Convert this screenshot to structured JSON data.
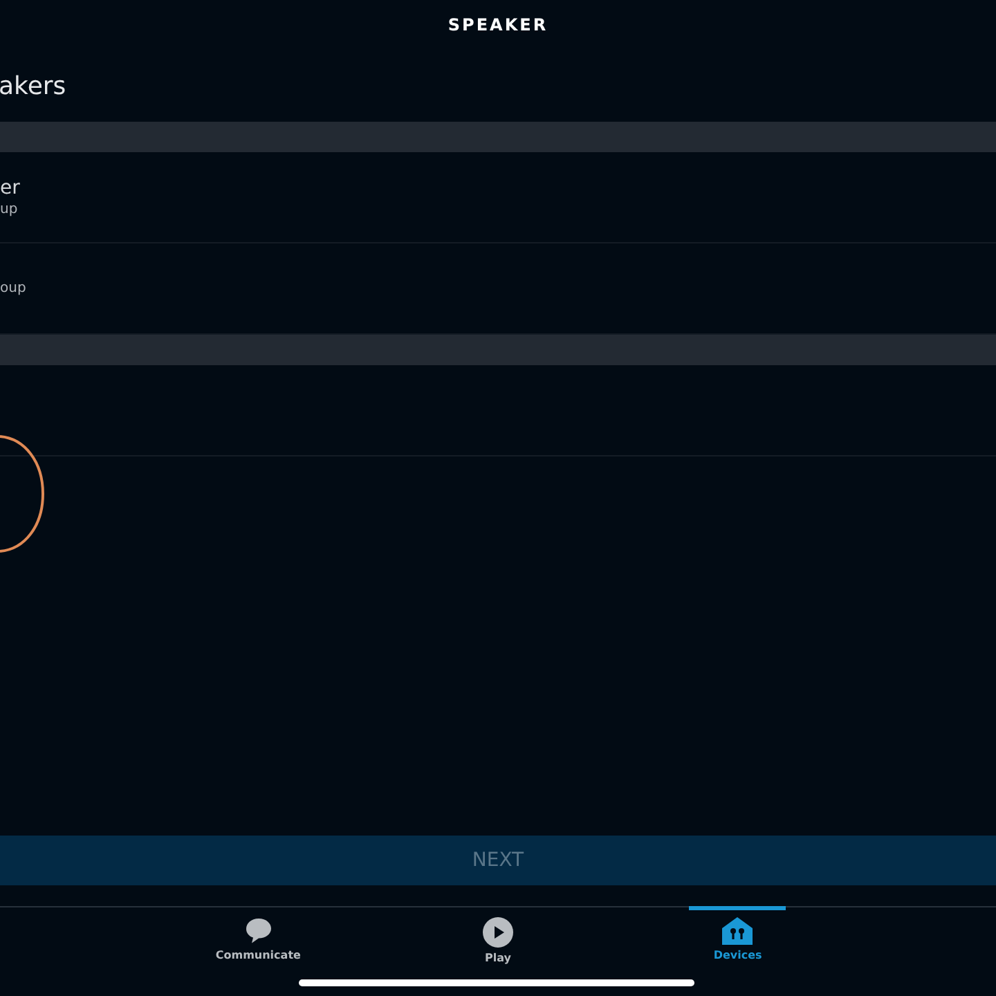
{
  "header": {
    "title": "SPEAKER"
  },
  "page_title": "akers",
  "sections": [
    {
      "rows": [
        {
          "title": "er",
          "subtitle": "up"
        },
        {
          "subtitle": "oup"
        }
      ]
    },
    {
      "rows": [
        {}
      ]
    }
  ],
  "next_button": {
    "label": "NEXT",
    "disabled": true
  },
  "tab_bar": [
    {
      "kind": "communicate",
      "label": "Communicate",
      "selected": false
    },
    {
      "kind": "play",
      "label": "Play",
      "selected": false
    },
    {
      "kind": "devices",
      "label": "Devices",
      "selected": true
    }
  ]
}
